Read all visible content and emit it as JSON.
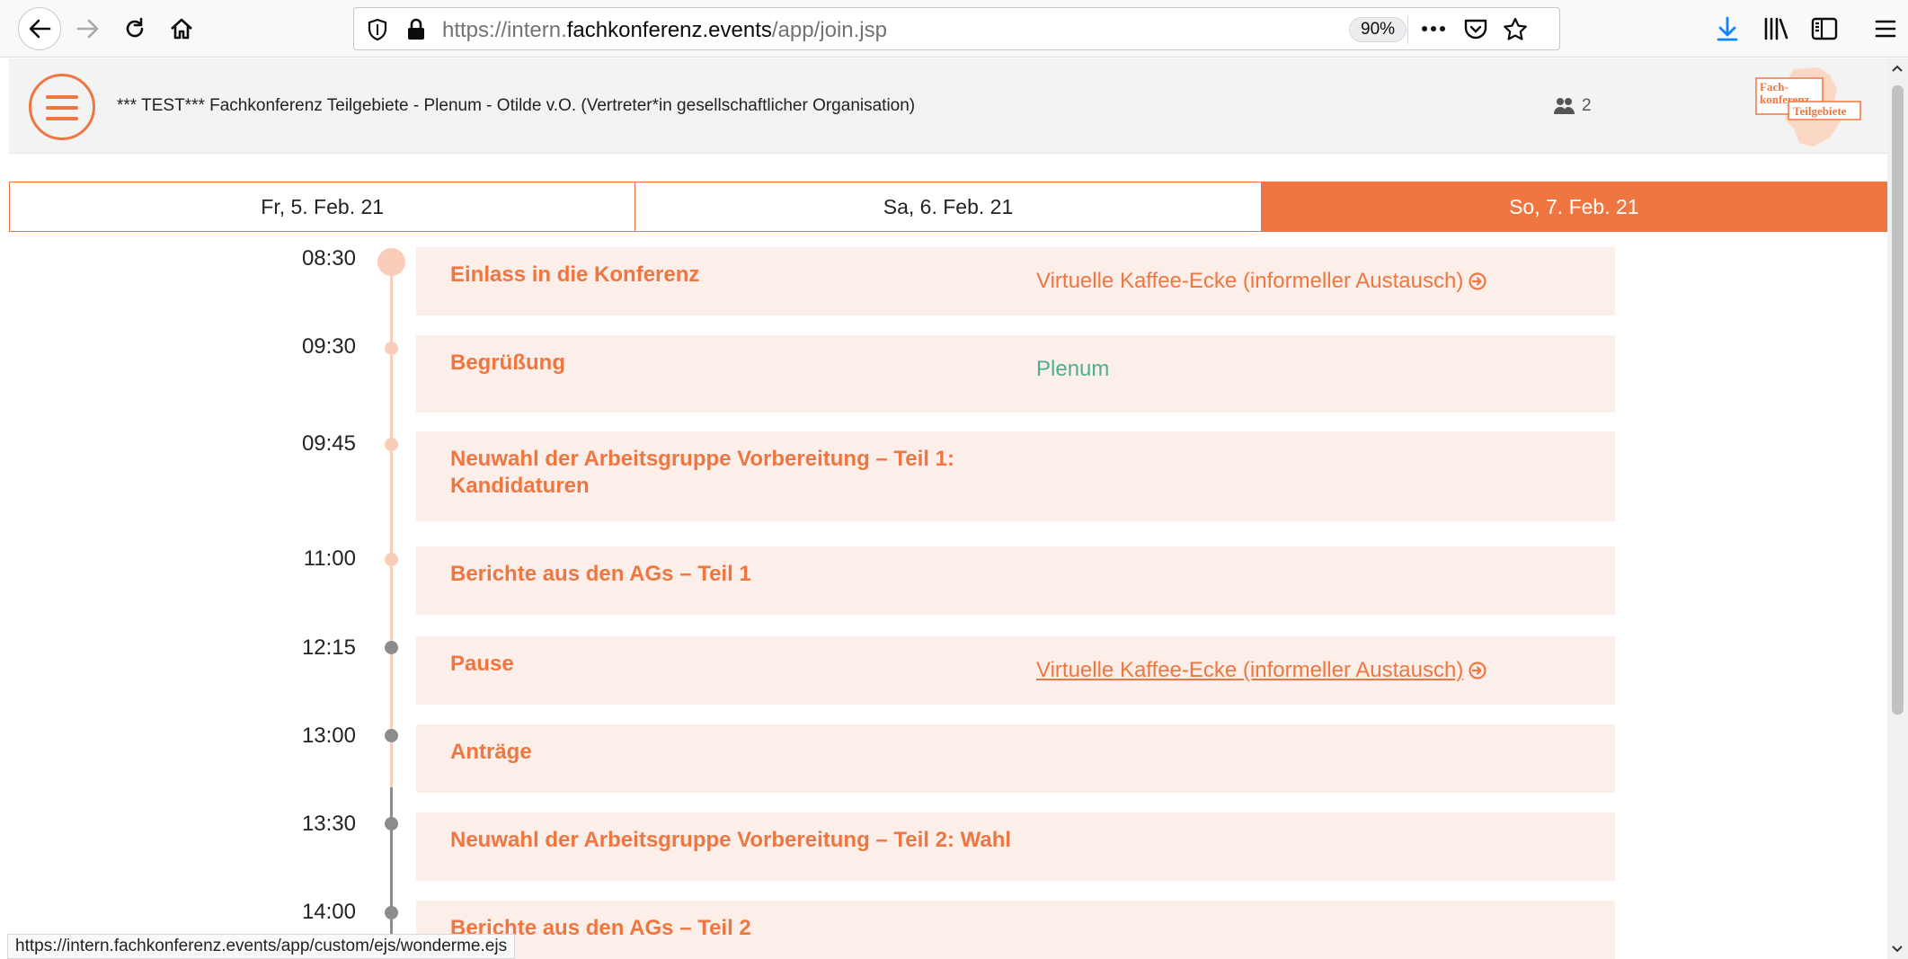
{
  "browser": {
    "url_prefix": "https://intern.",
    "url_domain": "fachkonferenz.events",
    "url_path": "/app/join.jsp",
    "zoom": "90%"
  },
  "header": {
    "title": "*** TEST*** Fachkonferenz Teilgebiete - Plenum - Otilde v.O. (Vertreter*in gesellschaftlicher Organisation)",
    "users_count": "2",
    "logo_line1": "Fach-",
    "logo_line2": "konferenz",
    "logo_line3": "Teilgebiete"
  },
  "days": [
    {
      "label": "Fr, 5. Feb. 21",
      "active": false
    },
    {
      "label": "Sa, 6. Feb. 21",
      "active": false
    },
    {
      "label": "So, 7. Feb. 21",
      "active": true
    }
  ],
  "events": [
    {
      "time": "08:30",
      "title": "Einlass in die Konferenz",
      "room": "Virtuelle Kaffee-Ecke (informeller Austausch)"
    },
    {
      "time": "09:30",
      "title": "Begrüßung",
      "room": "Plenum"
    },
    {
      "time": "09:45",
      "title": "Neuwahl der Arbeitsgruppe Vorbereitung – Teil 1: Kandidaturen",
      "room": ""
    },
    {
      "time": "11:00",
      "title": "Berichte aus den AGs – Teil 1",
      "room": ""
    },
    {
      "time": "12:15",
      "title": "Pause",
      "room": "Virtuelle Kaffee-Ecke (informeller Austausch)"
    },
    {
      "time": "13:00",
      "title": "Anträge",
      "room": ""
    },
    {
      "time": "13:30",
      "title": "Neuwahl der Arbeitsgruppe Vorbereitung – Teil 2: Wahl",
      "room": ""
    },
    {
      "time": "14:00",
      "title": "Berichte aus den AGs – Teil 2",
      "room": ""
    }
  ],
  "status_bar": "https://intern.fachkonferenz.events/app/custom/ejs/wonderme.ejs",
  "colors": {
    "accent": "#ef7640",
    "card_bg": "#fcefe9",
    "plenum": "#4caf8f"
  }
}
